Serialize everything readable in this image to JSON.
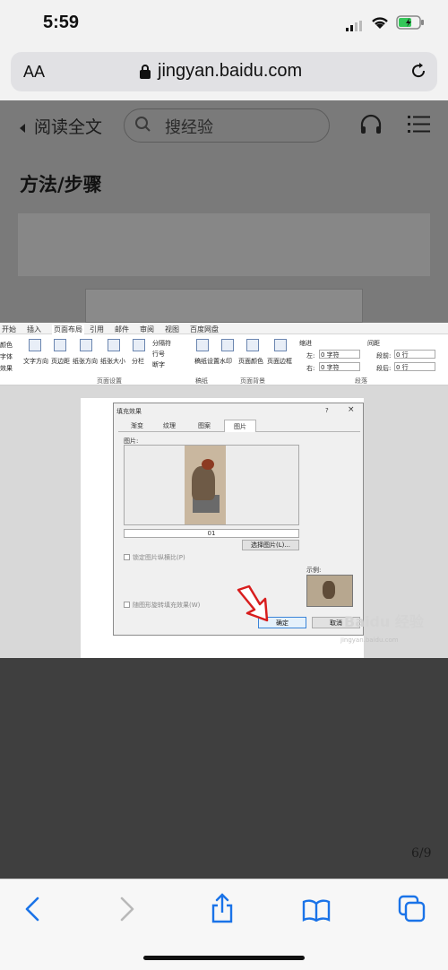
{
  "status_bar": {
    "time": "5:59"
  },
  "browser": {
    "text_size_label": "AA",
    "url": "jingyan.baidu.com"
  },
  "page_header": {
    "read_full_text": "阅读全文",
    "search_placeholder": "搜经验"
  },
  "article": {
    "section_heading": "方法/步骤",
    "page_indicator": "6/9"
  },
  "ribbon": {
    "tabs": [
      "开始",
      "插入",
      "页面布局",
      "引用",
      "邮件",
      "审阅",
      "视图",
      "百度网盘"
    ],
    "buttons": [
      "文字方向",
      "页边距",
      "纸张方向",
      "纸张大小",
      "分栏",
      "稿纸设置",
      "水印",
      "页面颜色",
      "页面边框"
    ],
    "small_items": [
      "分隔符",
      "行号",
      "断字"
    ],
    "left_items": [
      "颜色",
      "字体",
      "效果"
    ],
    "indent_label": "缩进",
    "spacing_label": "间距",
    "indent_left": "左:",
    "indent_right": "右:",
    "indent_value": "0 字符",
    "spacing_before": "段前:",
    "spacing_after": "段后:",
    "spacing_value": "0 行",
    "groups": [
      "页面设置",
      "稿纸",
      "页面背景",
      "段落"
    ]
  },
  "dialog": {
    "title": "填充效果",
    "tabs": [
      "渐变",
      "纹理",
      "图案",
      "图片"
    ],
    "picture_label": "图片:",
    "image_name": "01",
    "select_button": "选择图片(L)...",
    "lock_aspect": "锁定图片纵横比(P)",
    "rotate_with_shape": "随图形旋转填充效果(W)",
    "sample_label": "示例:",
    "ok": "确定",
    "cancel": "取消",
    "help": "?",
    "close": "×"
  },
  "watermark": {
    "brand": "Baidu 经验",
    "site": "jingyan.baidu.com"
  },
  "colors": {
    "accent": "#1a73e8",
    "arrow": "#d81e1e"
  }
}
